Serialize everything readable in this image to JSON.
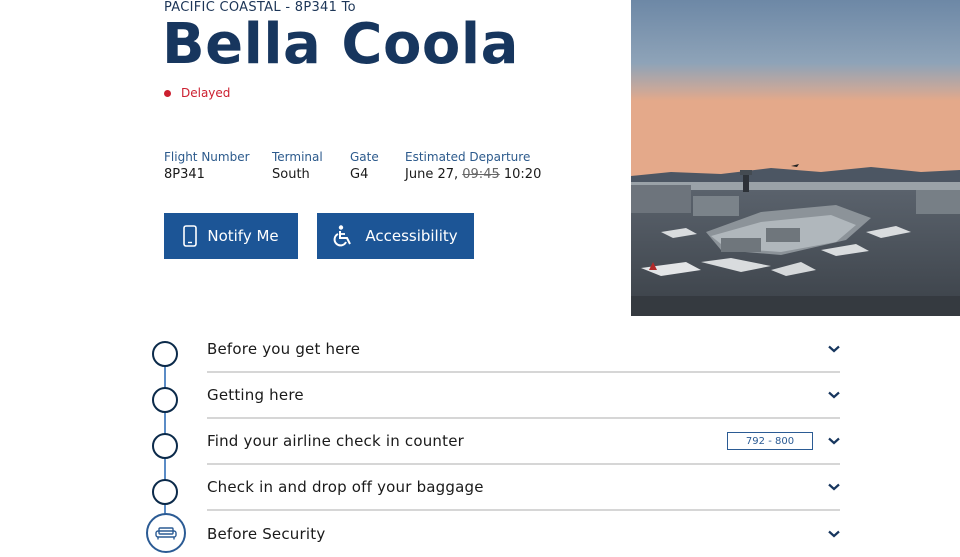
{
  "flight": {
    "subtitle": "PACIFIC COASTAL - 8P341 To",
    "destination": "Bella Coola",
    "status": "Delayed",
    "status_color": "#cc1f2f"
  },
  "info": {
    "flight_number_label": "Flight Number",
    "flight_number": "8P341",
    "terminal_label": "Terminal",
    "terminal": "South",
    "gate_label": "Gate",
    "gate": "G4",
    "departure_label": "Estimated Departure",
    "departure_date": "June 27,",
    "departure_old_time": "09:45",
    "departure_new_time": "10:20"
  },
  "buttons": {
    "notify": "Notify Me",
    "notify_icon": "phone-icon",
    "accessibility": "Accessibility",
    "accessibility_icon": "wheelchair-icon"
  },
  "steps": [
    {
      "label": "Before you get here"
    },
    {
      "label": "Getting here"
    },
    {
      "label": "Find your airline check in counter",
      "badge": "792 - 800"
    },
    {
      "label": "Check in and drop off your baggage"
    },
    {
      "label": "Before Security",
      "icon": "sofa-icon"
    }
  ],
  "colors": {
    "brand_blue": "#1c5596",
    "title_navy": "#17365e"
  }
}
